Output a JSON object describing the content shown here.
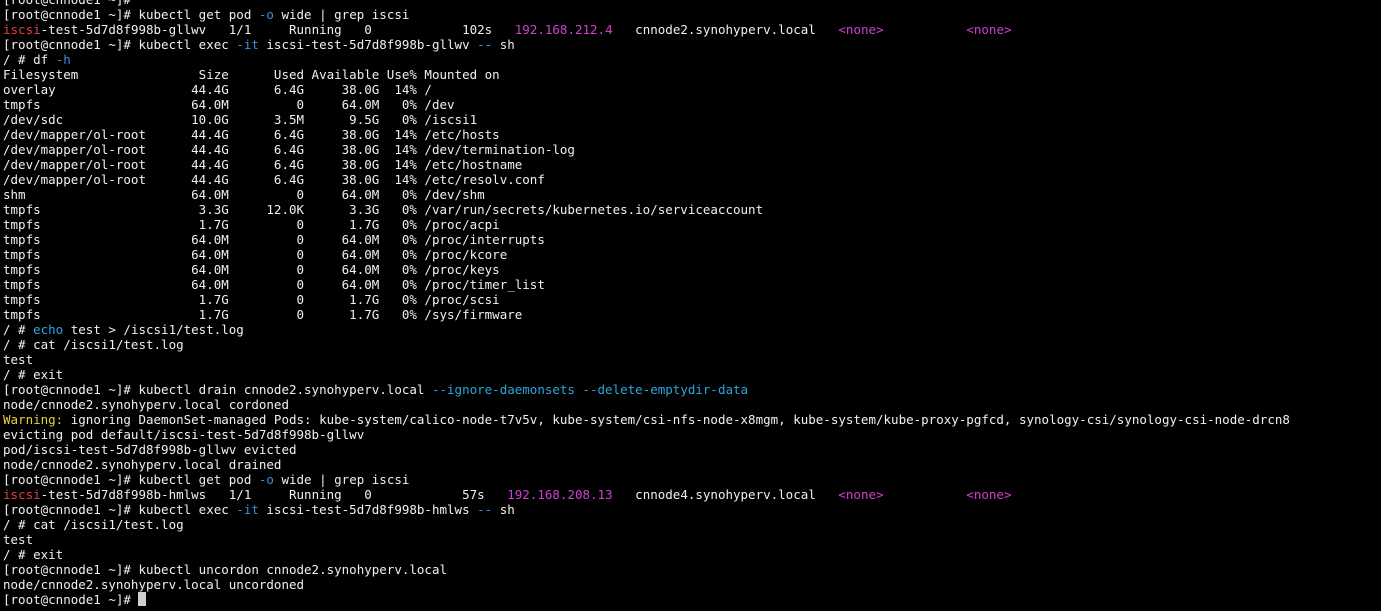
{
  "colors": {
    "background": "#000000",
    "text": "#f0f0f0",
    "grep_match": "#e04040",
    "flag": "#3a8ee6",
    "option": "#2aa7e0",
    "highlight": "#d040d0",
    "warning": "#e8d040"
  },
  "terminal": {
    "lines": [
      [
        {
          "t": "[root@cnnode1 ~]#",
          "c": "default"
        }
      ],
      [
        {
          "t": "[root@cnnode1 ~]# kubectl get pod ",
          "c": "default"
        },
        {
          "t": "-o",
          "c": "blue"
        },
        {
          "t": " wide | grep iscsi",
          "c": "default"
        }
      ],
      [
        {
          "t": "iscsi",
          "c": "red"
        },
        {
          "t": "-test-5d7d8f998b-gllwv   1/1     Running   0            102s   ",
          "c": "default"
        },
        {
          "t": "192.168.212.4",
          "c": "magenta"
        },
        {
          "t": "   cnnode2.synohyperv.local   ",
          "c": "default"
        },
        {
          "t": "<none>",
          "c": "magenta"
        },
        {
          "t": "           ",
          "c": "default"
        },
        {
          "t": "<none>",
          "c": "magenta"
        }
      ],
      [
        {
          "t": "[root@cnnode1 ~]# kubectl exec ",
          "c": "default"
        },
        {
          "t": "-it",
          "c": "blue"
        },
        {
          "t": " iscsi-test-5d7d8f998b-gllwv ",
          "c": "default"
        },
        {
          "t": "--",
          "c": "blue"
        },
        {
          "t": " sh",
          "c": "default"
        }
      ],
      [
        {
          "t": "/ # df ",
          "c": "default"
        },
        {
          "t": "-h",
          "c": "blue"
        }
      ],
      [
        {
          "t": "Filesystem                Size      Used Available Use% Mounted on",
          "c": "default"
        }
      ],
      [
        {
          "t": "overlay                  44.4G      6.4G     38.0G  14% /",
          "c": "default"
        }
      ],
      [
        {
          "t": "tmpfs                    64.0M         0     64.0M   0% /dev",
          "c": "default"
        }
      ],
      [
        {
          "t": "/dev/sdc                 10.0G      3.5M      9.5G   0% /iscsi1",
          "c": "default"
        }
      ],
      [
        {
          "t": "/dev/mapper/ol-root      44.4G      6.4G     38.0G  14% /etc/hosts",
          "c": "default"
        }
      ],
      [
        {
          "t": "/dev/mapper/ol-root      44.4G      6.4G     38.0G  14% /dev/termination-log",
          "c": "default"
        }
      ],
      [
        {
          "t": "/dev/mapper/ol-root      44.4G      6.4G     38.0G  14% /etc/hostname",
          "c": "default"
        }
      ],
      [
        {
          "t": "/dev/mapper/ol-root      44.4G      6.4G     38.0G  14% /etc/resolv.conf",
          "c": "default"
        }
      ],
      [
        {
          "t": "shm                      64.0M         0     64.0M   0% /dev/shm",
          "c": "default"
        }
      ],
      [
        {
          "t": "tmpfs                     3.3G     12.0K      3.3G   0% /var/run/secrets/kubernetes.io/serviceaccount",
          "c": "default"
        }
      ],
      [
        {
          "t": "tmpfs                     1.7G         0      1.7G   0% /proc/acpi",
          "c": "default"
        }
      ],
      [
        {
          "t": "tmpfs                    64.0M         0     64.0M   0% /proc/interrupts",
          "c": "default"
        }
      ],
      [
        {
          "t": "tmpfs                    64.0M         0     64.0M   0% /proc/kcore",
          "c": "default"
        }
      ],
      [
        {
          "t": "tmpfs                    64.0M         0     64.0M   0% /proc/keys",
          "c": "default"
        }
      ],
      [
        {
          "t": "tmpfs                    64.0M         0     64.0M   0% /proc/timer_list",
          "c": "default"
        }
      ],
      [
        {
          "t": "tmpfs                     1.7G         0      1.7G   0% /proc/scsi",
          "c": "default"
        }
      ],
      [
        {
          "t": "tmpfs                     1.7G         0      1.7G   0% /sys/firmware",
          "c": "default"
        }
      ],
      [
        {
          "t": "/ # ",
          "c": "default"
        },
        {
          "t": "echo",
          "c": "cyan"
        },
        {
          "t": " test > /iscsi1/test.log",
          "c": "default"
        }
      ],
      [
        {
          "t": "/ # cat /iscsi1/test.log",
          "c": "default"
        }
      ],
      [
        {
          "t": "test",
          "c": "default"
        }
      ],
      [
        {
          "t": "/ # exit",
          "c": "default"
        }
      ],
      [
        {
          "t": "[root@cnnode1 ~]# kubectl drain cnnode2.synohyperv.local ",
          "c": "default"
        },
        {
          "t": "--ignore-daemonsets --delete-emptydir-data",
          "c": "cyan"
        }
      ],
      [
        {
          "t": "node/cnnode2.synohyperv.local cordoned",
          "c": "default"
        }
      ],
      [
        {
          "t": "Warning:",
          "c": "yellow"
        },
        {
          "t": " ignoring DaemonSet-managed Pods: kube-system/calico-node-t7v5v, kube-system/csi-nfs-node-x8mgm, kube-system/kube-proxy-pgfcd, synology-csi/synology-csi-node-drcn8",
          "c": "default"
        }
      ],
      [
        {
          "t": "evicting pod default/iscsi-test-5d7d8f998b-gllwv",
          "c": "default"
        }
      ],
      [
        {
          "t": "pod/iscsi-test-5d7d8f998b-gllwv evicted",
          "c": "default"
        }
      ],
      [
        {
          "t": "node/cnnode2.synohyperv.local drained",
          "c": "default"
        }
      ],
      [
        {
          "t": "[root@cnnode1 ~]# kubectl get pod ",
          "c": "default"
        },
        {
          "t": "-o",
          "c": "blue"
        },
        {
          "t": " wide | grep iscsi",
          "c": "default"
        }
      ],
      [
        {
          "t": "iscsi",
          "c": "red"
        },
        {
          "t": "-test-5d7d8f998b-hmlws   1/1     Running   0            57s   ",
          "c": "default"
        },
        {
          "t": "192.168.208.13",
          "c": "magenta"
        },
        {
          "t": "   cnnode4.synohyperv.local   ",
          "c": "default"
        },
        {
          "t": "<none>",
          "c": "magenta"
        },
        {
          "t": "           ",
          "c": "default"
        },
        {
          "t": "<none>",
          "c": "magenta"
        }
      ],
      [
        {
          "t": "[root@cnnode1 ~]# kubectl exec ",
          "c": "default"
        },
        {
          "t": "-it",
          "c": "blue"
        },
        {
          "t": " iscsi-test-5d7d8f998b-hmlws ",
          "c": "default"
        },
        {
          "t": "--",
          "c": "blue"
        },
        {
          "t": " sh",
          "c": "default"
        }
      ],
      [
        {
          "t": "/ # cat /iscsi1/test.log",
          "c": "default"
        }
      ],
      [
        {
          "t": "test",
          "c": "default"
        }
      ],
      [
        {
          "t": "/ # exit",
          "c": "default"
        }
      ],
      [
        {
          "t": "[root@cnnode1 ~]# kubectl uncordon cnnode2.synohyperv.local",
          "c": "default"
        }
      ],
      [
        {
          "t": "node/cnnode2.synohyperv.local uncordoned",
          "c": "default"
        }
      ],
      [
        {
          "t": "[root@cnnode1 ~]# ",
          "c": "default"
        }
      ]
    ]
  }
}
